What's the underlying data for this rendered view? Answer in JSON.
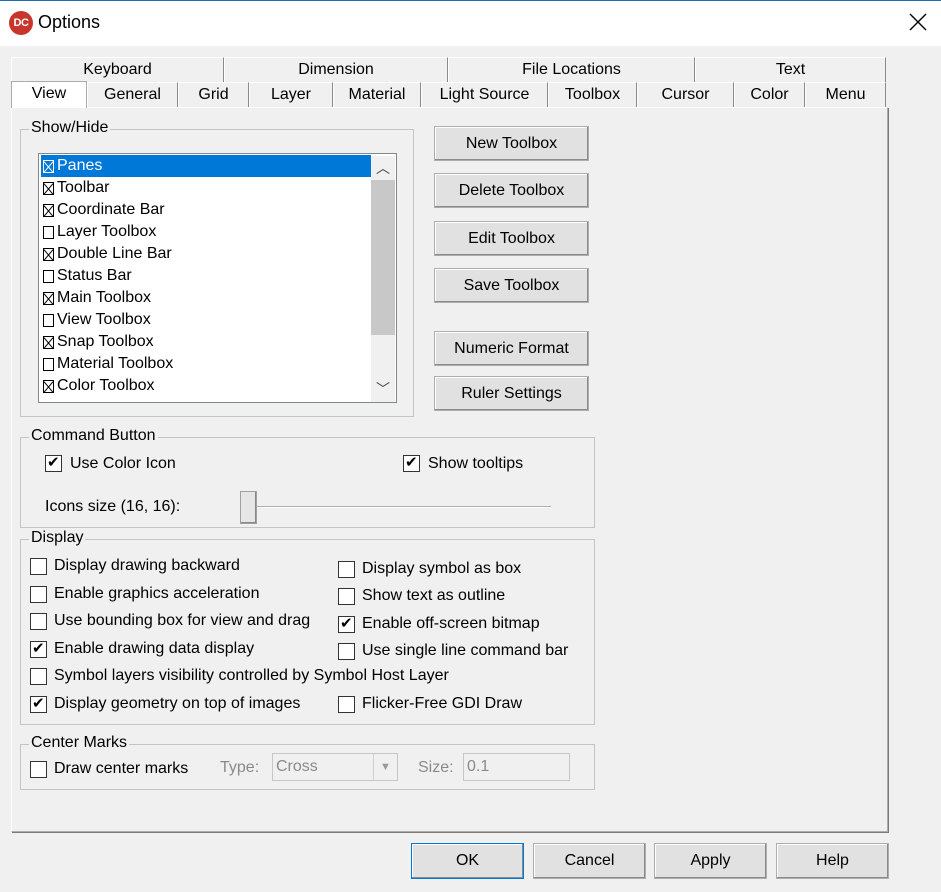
{
  "window": {
    "title": "Options",
    "app_icon_text": "DC"
  },
  "tabs_row1": [
    "Keyboard",
    "Dimension",
    "File Locations",
    "Text"
  ],
  "tabs_row2": [
    "View",
    "General",
    "Grid",
    "Layer",
    "Material",
    "Light Source",
    "Toolbox",
    "Cursor",
    "Color",
    "Menu"
  ],
  "active_tab": "View",
  "show_hide": {
    "label": "Show/Hide",
    "items": [
      {
        "label": "Panes",
        "checked": true,
        "selected": true
      },
      {
        "label": "Toolbar",
        "checked": true
      },
      {
        "label": "Coordinate Bar",
        "checked": true
      },
      {
        "label": "Layer Toolbox",
        "checked": false
      },
      {
        "label": "Double Line Bar",
        "checked": true
      },
      {
        "label": "Status Bar",
        "checked": false
      },
      {
        "label": "Main Toolbox",
        "checked": true
      },
      {
        "label": "View Toolbox",
        "checked": false
      },
      {
        "label": "Snap Toolbox",
        "checked": true
      },
      {
        "label": "Material Toolbox",
        "checked": false
      },
      {
        "label": "Color Toolbox",
        "checked": true
      }
    ]
  },
  "toolbox_buttons": {
    "new": "New Toolbox",
    "delete": "Delete Toolbox",
    "edit": "Edit Toolbox",
    "save": "Save Toolbox",
    "numeric": "Numeric Format",
    "ruler": "Ruler Settings"
  },
  "command_button": {
    "label": "Command Button",
    "use_color_icon": {
      "label": "Use Color Icon",
      "checked": true
    },
    "show_tooltips": {
      "label": "Show tooltips",
      "checked": true
    },
    "icons_size_label": "Icons size (16, 16):",
    "icons_size_slider_value": 0
  },
  "display": {
    "label": "Display",
    "left": [
      {
        "label": "Display drawing backward",
        "checked": false
      },
      {
        "label": "Enable graphics acceleration",
        "checked": false
      },
      {
        "label": "Use bounding box for view and drag",
        "checked": false
      },
      {
        "label": "Enable drawing data display",
        "checked": true
      },
      {
        "label": "Symbol layers visibility controlled by Symbol Host Layer",
        "checked": false
      },
      {
        "label": "Display geometry on top of images",
        "checked": true
      }
    ],
    "right": [
      {
        "label": "Display symbol as box",
        "checked": false
      },
      {
        "label": "Show text as outline",
        "checked": false
      },
      {
        "label": "Enable off-screen bitmap",
        "checked": true
      },
      {
        "label": "Use single line command bar",
        "checked": false
      },
      {
        "label": "Flicker-Free GDI Draw",
        "checked": false
      }
    ]
  },
  "center_marks": {
    "label": "Center Marks",
    "draw": {
      "label": "Draw center marks",
      "checked": false
    },
    "type_label": "Type:",
    "type_value": "Cross",
    "size_label": "Size:",
    "size_value": "0.1"
  },
  "footer": {
    "ok": "OK",
    "cancel": "Cancel",
    "apply": "Apply",
    "help": "Help"
  }
}
